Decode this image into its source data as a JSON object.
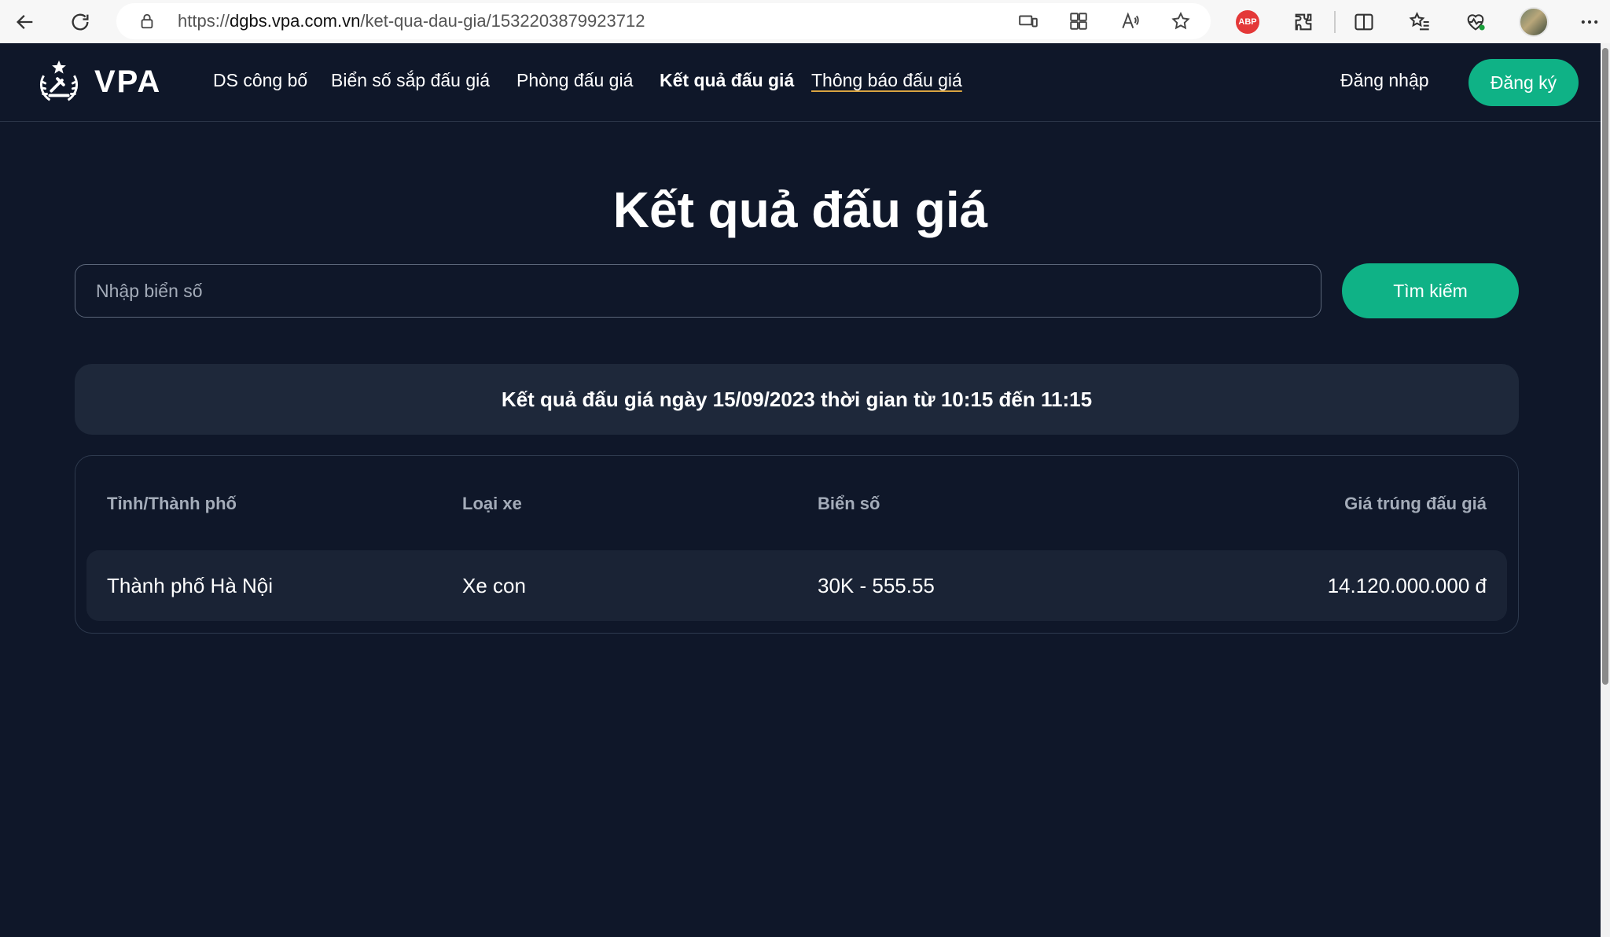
{
  "browser": {
    "url_scheme": "https://",
    "url_host": "dgbs.vpa.com.vn",
    "url_path": "/ket-qua-dau-gia/1532203879923712",
    "abp_label": "ABP"
  },
  "header": {
    "logo_text": "VPA",
    "nav": [
      {
        "label": "DS công bố"
      },
      {
        "label": "Biển số sắp đấu giá"
      },
      {
        "label": "Phòng đấu giá"
      },
      {
        "label": "Kết quả đấu giá"
      },
      {
        "label": "Thông báo đấu giá"
      }
    ],
    "login_label": "Đăng nhập",
    "signup_label": "Đăng ký"
  },
  "main": {
    "title": "Kết quả đấu giá",
    "search": {
      "placeholder": "Nhập biển số",
      "value": "",
      "button_label": "Tìm kiếm"
    },
    "result_banner": "Kết quả đấu giá ngày 15/09/2023 thời gian từ 10:15 đến 11:15",
    "table": {
      "headers": [
        "Tỉnh/Thành phố",
        "Loại xe",
        "Biển số",
        "Giá trúng đấu giá"
      ],
      "rows": [
        [
          "Thành phố Hà Nội",
          "Xe con",
          "30K - 555.55",
          "14.120.000.000 đ"
        ]
      ]
    }
  },
  "colors": {
    "background": "#0f1729",
    "accent": "#0fb286",
    "card": "#1e283a",
    "muted_text": "#a4acb9"
  }
}
